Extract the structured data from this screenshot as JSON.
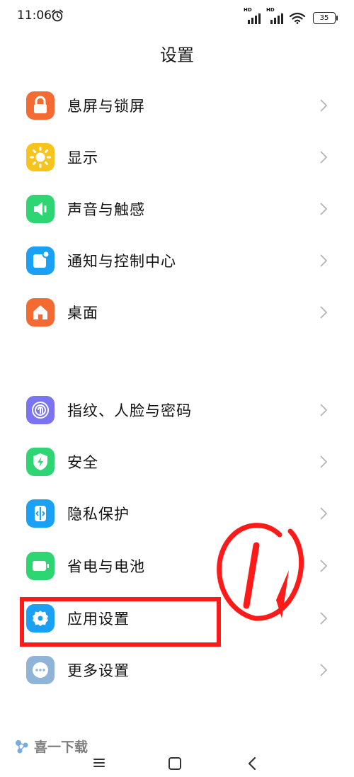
{
  "status_bar": {
    "time": "11:06",
    "signal1_label": "HD",
    "signal2_label": "HD",
    "battery": "35"
  },
  "page_title": "设置",
  "groups": [
    {
      "items": [
        {
          "label": "息屏与锁屏",
          "icon": "lock-icon",
          "color": "#f36b33"
        },
        {
          "label": "显示",
          "icon": "sun-icon",
          "color": "#f7c31d"
        },
        {
          "label": "声音与触感",
          "icon": "speaker-icon",
          "color": "#2ed573"
        },
        {
          "label": "通知与控制中心",
          "icon": "notification-icon",
          "color": "#1aa1f5"
        },
        {
          "label": "桌面",
          "icon": "home-icon",
          "color": "#f36b33"
        }
      ]
    },
    {
      "items": [
        {
          "label": "指纹、人脸与密码",
          "icon": "fingerprint-icon",
          "color": "#7b74f0"
        },
        {
          "label": "安全",
          "icon": "shield-bolt-icon",
          "color": "#2ed573"
        },
        {
          "label": "隐私保护",
          "icon": "privacy-icon",
          "color": "#1aa1f5"
        },
        {
          "label": "省电与电池",
          "icon": "battery-icon",
          "color": "#2ed573"
        },
        {
          "label": "应用设置",
          "icon": "gear-icon",
          "color": "#1aa1f5"
        },
        {
          "label": "更多设置",
          "icon": "more-icon",
          "color": "#8fb4d8"
        }
      ]
    }
  ],
  "annotation": {
    "color": "#ff1a1a",
    "highlighted_item": "应用设置"
  },
  "watermark": {
    "text": "喜一下载"
  }
}
